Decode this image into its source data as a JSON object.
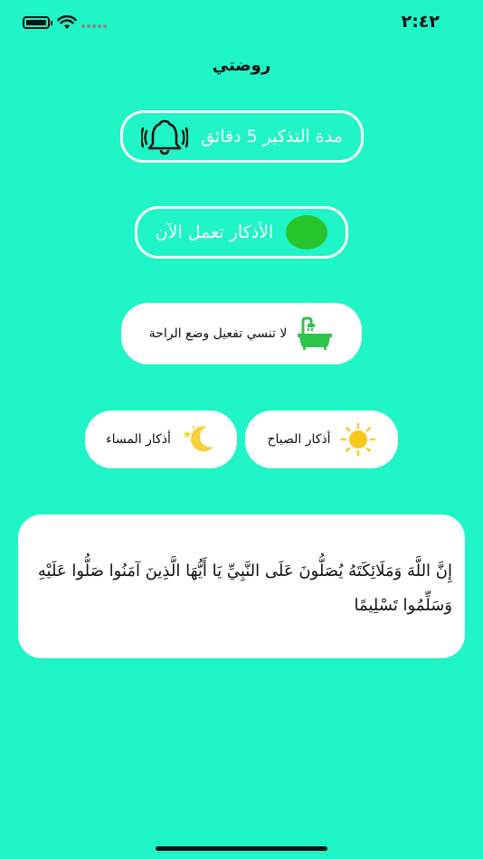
{
  "status_bar": {
    "time": "٢:٤٢"
  },
  "app": {
    "title": "روضتي"
  },
  "reminder": {
    "label": "مدة التذكير 5 دقائق",
    "icon": "bell-ringing-icon"
  },
  "toggle": {
    "label": "الأذكار تعمل الآن",
    "state_color": "#27c52b"
  },
  "rest_mode": {
    "label": "لا تنسي  تفعيل وضع الراحة",
    "icon": "bathtub-icon"
  },
  "morning": {
    "label": "أذكار الصباح",
    "icon": "sun-icon"
  },
  "evening": {
    "label": "أذكار المساء",
    "icon": "moon-icon"
  },
  "verse": {
    "text": "إِنَّ اللَّهَ وَمَلَائِكَتَهُ يُصَلُّونَ عَلَى النَّبِيِّ  يَا أَيُّهَا الَّذِينَ آمَنُوا صَلُّوا عَلَيْهِ وَسَلِّمُوا تَسْلِيمًا"
  },
  "colors": {
    "background": "#1ff5c6",
    "accent_green": "#27c52b",
    "sun": "#f8c81b",
    "moon": "#f6cf3a"
  }
}
